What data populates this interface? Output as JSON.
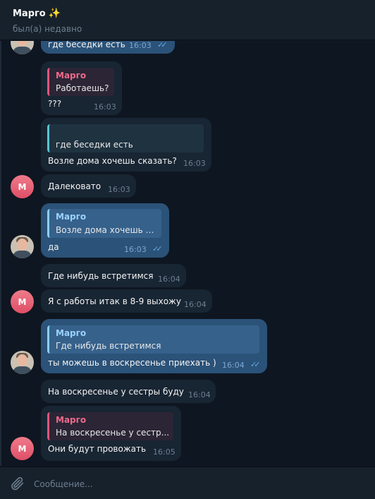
{
  "header": {
    "contact_name": "Марго",
    "sparkle": "✨",
    "status": "был(а) недавно"
  },
  "messages": [
    {
      "id": 1,
      "direction": "out",
      "text": "где беседки есть",
      "time": "16:03",
      "read": true
    },
    {
      "id": 2,
      "direction": "in",
      "reply_to": {
        "author": "Марго",
        "text": "Работаешь?"
      },
      "text": "???",
      "time": "16:03"
    },
    {
      "id": 3,
      "direction": "in",
      "reply_to": {
        "author": "",
        "text": "где беседки есть"
      },
      "text": "Возле дома хочешь сказать?",
      "time": "16:03"
    },
    {
      "id": 4,
      "direction": "in",
      "text": "Далековато",
      "time": "16:03",
      "avatar": "М"
    },
    {
      "id": 5,
      "direction": "out",
      "reply_to": {
        "author": "Марго",
        "text": "Возле дома хочешь с..."
      },
      "text": "да",
      "time": "16:03",
      "read": true
    },
    {
      "id": 6,
      "direction": "in",
      "text": "Где нибудь встретимся",
      "time": "16:04"
    },
    {
      "id": 7,
      "direction": "in",
      "text": "Я с работы итак в 8-9 выхожу",
      "time": "16:04",
      "avatar": "М"
    },
    {
      "id": 8,
      "direction": "out",
      "reply_to": {
        "author": "Марго",
        "text": "Где нибудь встретимся"
      },
      "text": "ты можешь в воскресенье приехать )",
      "time": "16:04",
      "read": true
    },
    {
      "id": 9,
      "direction": "in",
      "text": "На воскресенье у сестры буду",
      "time": "16:04"
    },
    {
      "id": 10,
      "direction": "in",
      "reply_to": {
        "author": "Марго",
        "text": "На воскресенье у сестр..."
      },
      "text": "Они будут провожать",
      "time": "16:05",
      "avatar": "М"
    }
  ],
  "read_checks": "✓✓",
  "composer": {
    "placeholder": "Сообщение...",
    "value": ""
  },
  "colors": {
    "background": "#0e1621",
    "header": "#17212b",
    "incoming_bubble": "#182533",
    "outgoing_bubble": "#2b5278",
    "avatar_m": "#e0566b",
    "reply_pink": "#e0557a",
    "reply_cyan": "#58c4d0",
    "check_blue": "#64a9e5"
  }
}
